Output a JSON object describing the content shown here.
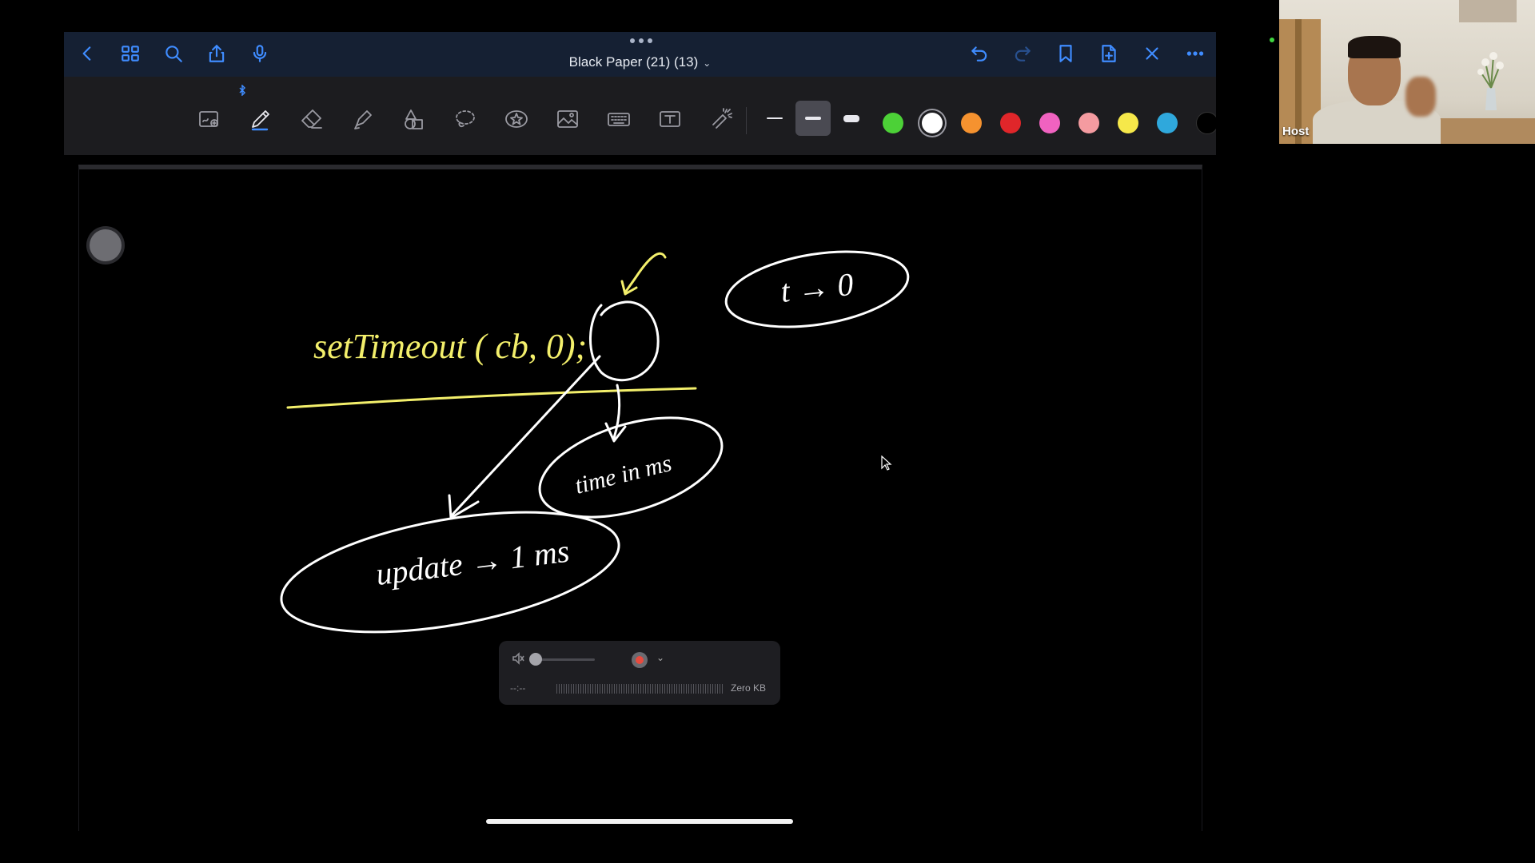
{
  "notes_app": {
    "document_title": "Black Paper  (21) (13)",
    "top_left_icons": [
      "back-chevron-icon",
      "thumbnails-grid-icon",
      "search-icon",
      "share-icon",
      "microphone-icon"
    ],
    "top_right_icons": [
      "undo-icon",
      "redo-icon",
      "bookmark-icon",
      "add-page-icon",
      "close-icon",
      "more-options-icon"
    ],
    "tools": [
      "zoom-window-icon",
      "pen-icon",
      "eraser-icon",
      "highlighter-icon",
      "shapes-icon",
      "lasso-icon",
      "sticker-icon",
      "image-icon",
      "keyboard-icon",
      "text-box-icon",
      "laser-pointer-icon"
    ],
    "selected_tool": "pen",
    "stroke_widths": [
      "thin",
      "medium",
      "thick"
    ],
    "selected_stroke_width": "medium",
    "colors": [
      "#4cd137",
      "#ffffff",
      "#f5922f",
      "#e0262a",
      "#f062c0",
      "#f49ba0",
      "#f6e84a",
      "#2fa8dc",
      "#000000"
    ],
    "selected_color": "#ffffff"
  },
  "canvas": {
    "ink_white": "#ffffff",
    "ink_yellow": "#f3ef6b",
    "handwritten_text": {
      "settimeout_call": "setTimeout ( cb, 0);",
      "t_to_zero": "t → 0",
      "time_in_ms": "time in ms",
      "update_1ms": "update → 1 ms"
    }
  },
  "recorder": {
    "time": "--:--",
    "size": "Zero KB"
  },
  "webcam": {
    "participant_label": "Host"
  }
}
